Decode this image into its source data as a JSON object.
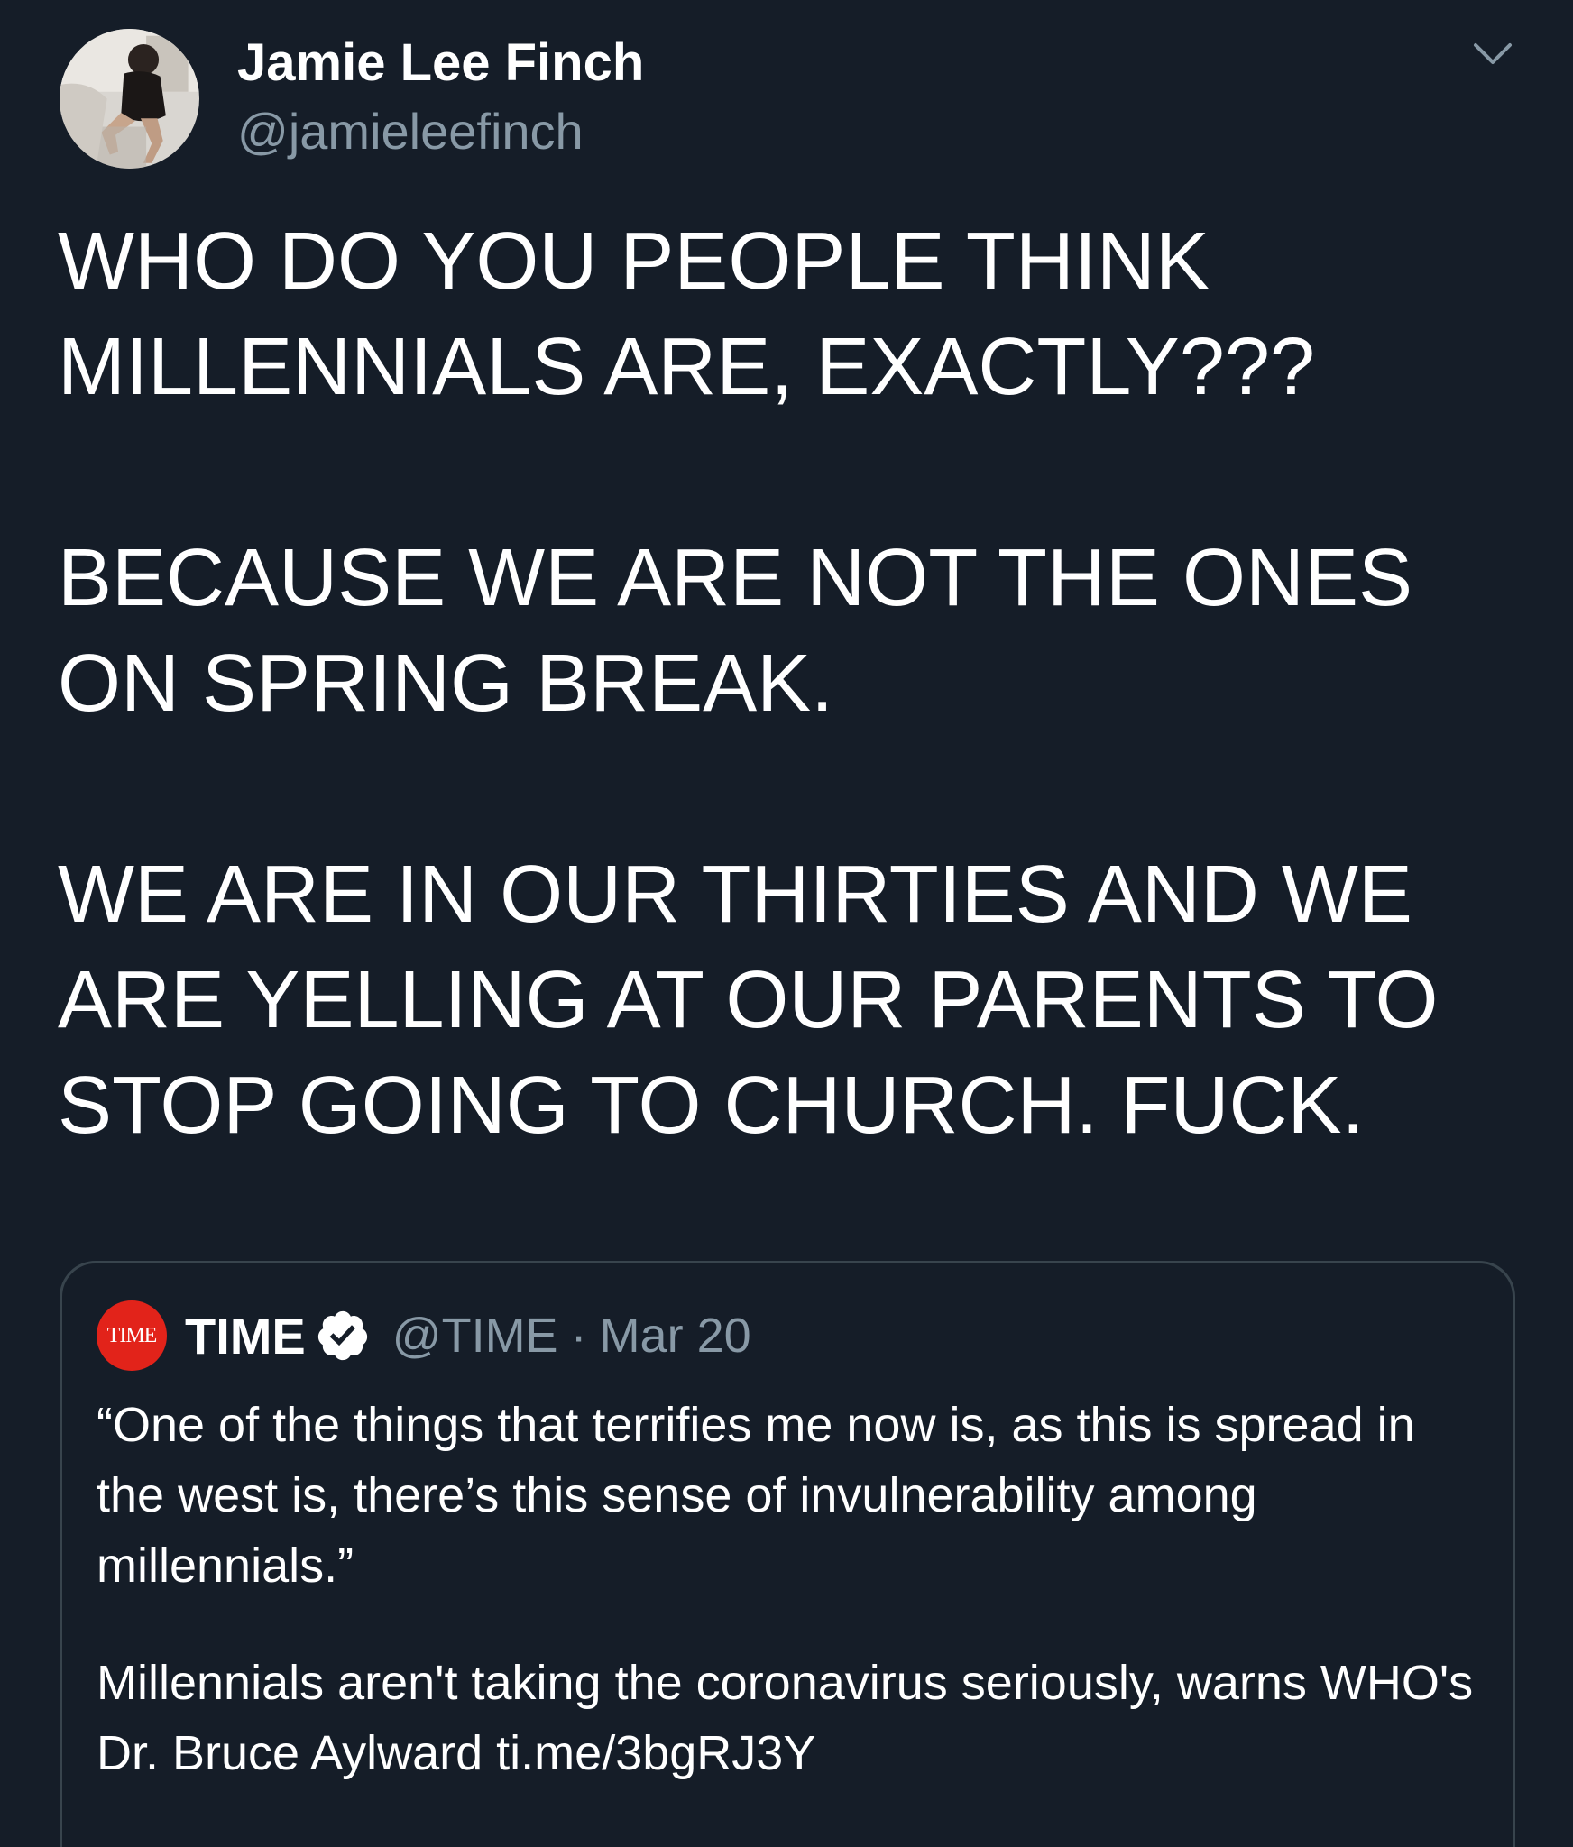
{
  "author": {
    "display_name": "Jamie Lee Finch",
    "handle": "@jamieleefinch"
  },
  "tweet": {
    "paragraphs": [
      "WHO DO YOU PEOPLE THINK MILLENNIALS ARE, EXACTLY???",
      "BECAUSE WE ARE NOT THE ONES ON SPRING BREAK.",
      "WE ARE IN OUR THIRTIES AND WE ARE YELLING AT OUR PARENTS TO STOP GOING TO CHURCH. FUCK."
    ]
  },
  "quoted_tweet": {
    "logo_text": "TIME",
    "display_name": "TIME",
    "handle": "@TIME",
    "separator": "·",
    "date": "Mar 20",
    "paragraphs": [
      "“One of the things that terrifies me now is, as this is spread in the west is, there’s this sense of invulnerability among millennials.”",
      "Millennials aren't taking the coronavirus seriously, warns WHO's Dr. Bruce Aylward ti.me/3bgRJ3Y"
    ]
  },
  "icons": {
    "avatar": "avatar-photo",
    "menu": "chevron-down-icon",
    "verified": "verified-badge-icon"
  },
  "colors": {
    "background": "#151d28",
    "text_primary": "#ffffff",
    "text_secondary": "#8899a6",
    "border": "#38444d",
    "time_red": "#e2231a"
  }
}
